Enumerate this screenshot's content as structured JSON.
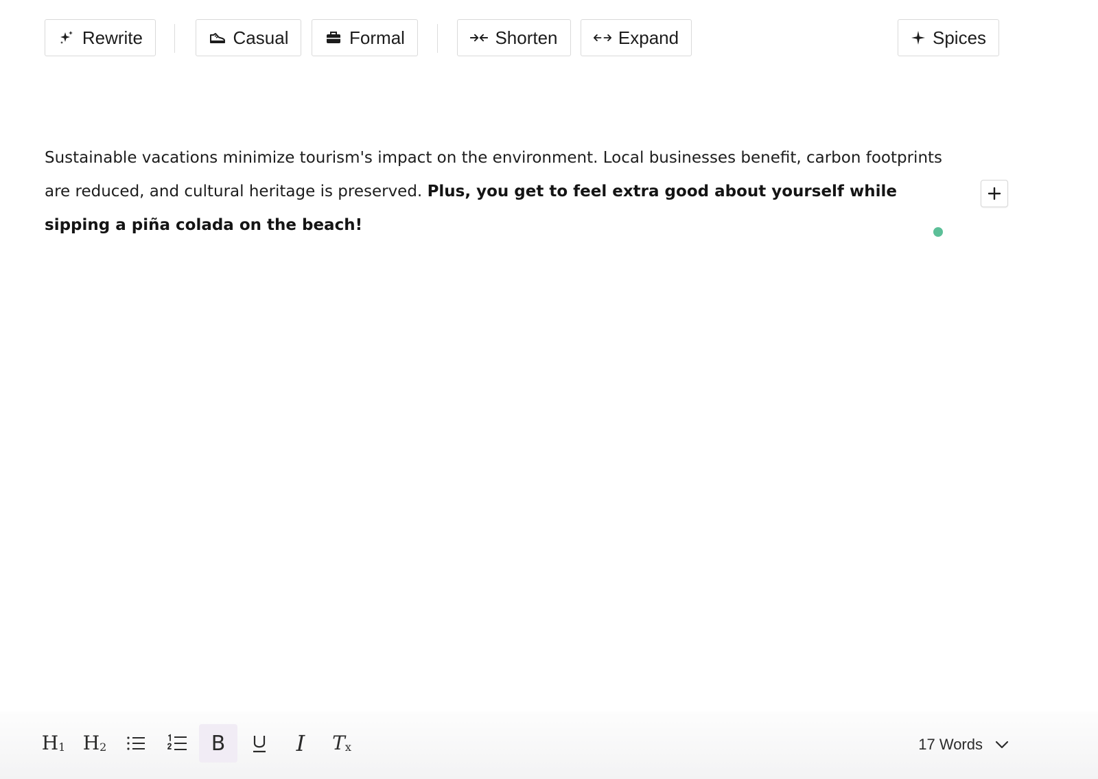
{
  "toolbar": {
    "rewrite": {
      "label": "Rewrite",
      "icon": "sparkles-icon"
    },
    "casual": {
      "label": "Casual",
      "icon": "sneaker-icon"
    },
    "formal": {
      "label": "Formal",
      "icon": "briefcase-icon"
    },
    "shorten": {
      "label": "Shorten",
      "icon": "arrows-in-icon"
    },
    "expand": {
      "label": "Expand",
      "icon": "arrows-out-icon"
    },
    "spices": {
      "label": "Spices",
      "icon": "sparkle-icon"
    }
  },
  "document": {
    "paragraph_plain": "Sustainable vacations minimize tourism's impact on the environment. Local businesses benefit, carbon footprints are reduced, and cultural heritage is preserved. ",
    "paragraph_bold": "Plus, you get to feel extra good about yourself while sipping a piña colada on the beach!",
    "add_block_icon": "plus-icon",
    "cursor_color": "#5cbf98"
  },
  "formatbar": {
    "h1": {
      "main": "H",
      "sub": "1"
    },
    "h2": {
      "main": "H",
      "sub": "2"
    },
    "bullet_list_icon": "bullet-list-icon",
    "numbered_list_icon": "numbered-list-icon",
    "bold": {
      "label": "B",
      "active": true
    },
    "underline_icon": "underline-icon",
    "italic": {
      "label": "I"
    },
    "clear_format": {
      "main": "T",
      "sub": "x"
    },
    "word_count": "17 Words",
    "active_bg": "#f1ecf5"
  }
}
